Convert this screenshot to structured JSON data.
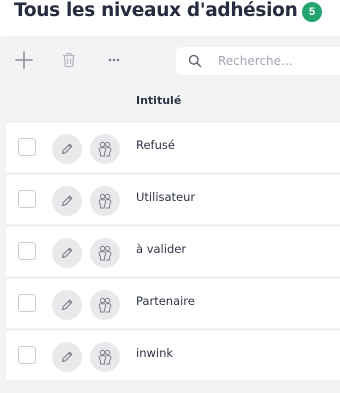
{
  "header": {
    "title": "Tous les niveaux d'adhésion",
    "count": "5"
  },
  "toolbar": {
    "add_icon": "plus-icon",
    "delete_icon": "trash-icon",
    "more_icon": "ellipsis-icon",
    "search_placeholder": "Recherche..."
  },
  "table": {
    "column_header": "Intitulé",
    "rows": [
      {
        "label": "Refusé"
      },
      {
        "label": "Utilisateur"
      },
      {
        "label": "à valider"
      },
      {
        "label": "Partenaire"
      },
      {
        "label": "inwink"
      }
    ]
  },
  "colors": {
    "badge": "#23a571",
    "page_background": "#f4f4f6",
    "row_background": "#ffffff"
  }
}
